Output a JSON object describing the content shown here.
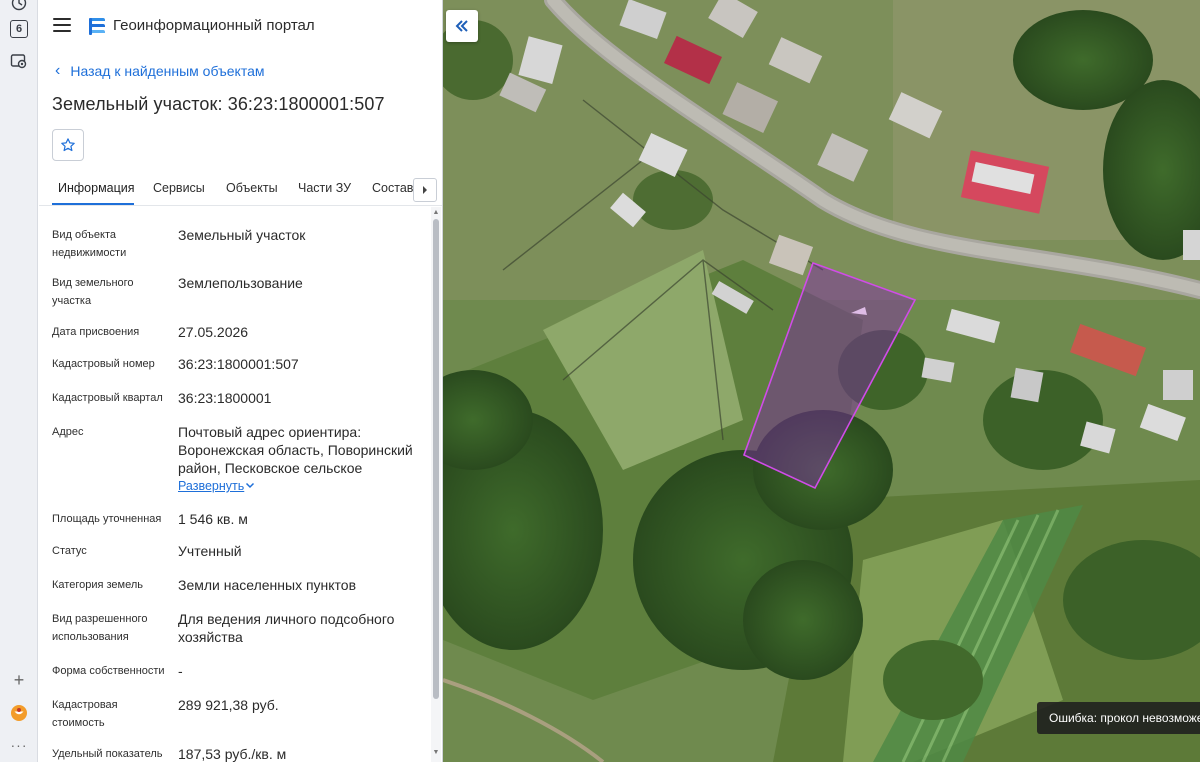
{
  "app": {
    "title": "Геоинформационный портал"
  },
  "nav": {
    "back_label": "Назад к найденным объектам"
  },
  "object": {
    "title": "Земельный участок: 36:23:1800001:507"
  },
  "strip": {
    "badge": "6"
  },
  "tabs": [
    {
      "label": "Информация",
      "active": true
    },
    {
      "label": "Сервисы"
    },
    {
      "label": "Объекты"
    },
    {
      "label": "Части ЗУ"
    },
    {
      "label": "Состав"
    }
  ],
  "properties": [
    {
      "label": "Вид объекта недвижимости",
      "value": "Земельный участок"
    },
    {
      "label": "Вид земельного участка",
      "value": "Землепользование"
    },
    {
      "label": "Дата присвоения",
      "value": "27.05.2026"
    },
    {
      "label": "Кадастровый номер",
      "value": "36:23:1800001:507"
    },
    {
      "label": "Кадастровый квартал",
      "value": "36:23:1800001"
    },
    {
      "label": "Адрес",
      "value": "Почтовый адрес ориентира: Воронежская область, Поворинский район, Песковское сельское",
      "expand_label": "Развернуть"
    },
    {
      "label": "Площадь уточненная",
      "value": "1 546 кв. м"
    },
    {
      "label": "Статус",
      "value": "Учтенный"
    },
    {
      "label": "Категория земель",
      "value": "Земли населенных пунктов"
    },
    {
      "label": "Вид разрешенного использования",
      "value": "Для ведения личного подсобного хозяйства"
    },
    {
      "label": "Форма собственности",
      "value": "-"
    },
    {
      "label": "Кадастровая стоимость",
      "value": "289 921,38 руб."
    },
    {
      "label": "Удельный показатель",
      "value": "187,53 руб./кв. м"
    }
  ],
  "map": {
    "error_toast": "Ошибка: прокол невозможен"
  },
  "colors": {
    "accent": "#1e6fd9",
    "parcel": "#c040e0"
  }
}
